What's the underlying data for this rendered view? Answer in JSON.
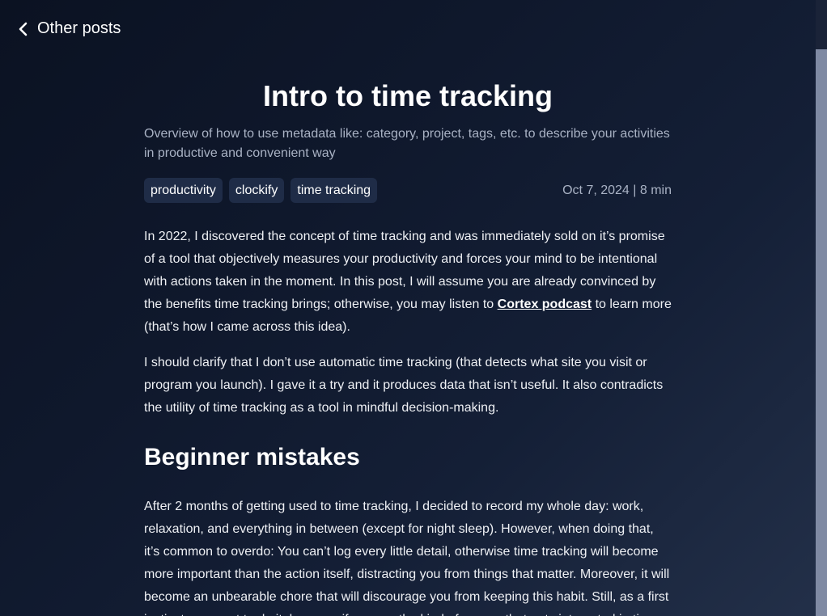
{
  "nav": {
    "back_label": "Other posts",
    "back_icon": "chevron-left-icon"
  },
  "post": {
    "title": "Intro to time tracking",
    "subtitle": "Overview of how to use metadata like: category, project, tags, etc. to describe your activities in productive and convenient way",
    "tags": [
      "productivity",
      "clockify",
      "time tracking"
    ],
    "date_info": "Oct 7, 2024 | 8 min",
    "paragraphs": {
      "p1_before": "In 2022, I discovered the concept of time tracking and was immediately sold on it’s promise of a tool that objectively measures your productivity and forces your mind to be intentional with actions taken in the moment. In this post, I will assume you are already convinced by the benefits time tracking brings; otherwise, you may listen to ",
      "p1_link": "Cortex podcast",
      "p1_after": " to learn more (that’s how I came across this idea).",
      "p2": "I should clarify that I don’t use automatic time tracking (that detects what site you visit or program you launch). I gave it a try and it produces data that isn’t useful. It also contradicts the utility of time tracking as a tool in mindful decision-making.",
      "section_heading": "Beginner mistakes",
      "p3": "After 2 months of getting used to time tracking, I decided to record my whole day: work, relaxation, and everything in between (except for night sleep). However, when doing that, it’s common to overdo: You can’t log every little detail, otherwise time tracking will become more important than the action itself, distracting you from things that matter. Moreover, it will become an unbearable chore that will discourage you from keeping this habit. Still, as a first instinct you want to do it, because if you are the kind of person that gets interested in time"
    }
  },
  "colors": {
    "background": "#0f182c",
    "tag_bg": "#1f2c47",
    "muted_text": "#a9b2c4"
  }
}
